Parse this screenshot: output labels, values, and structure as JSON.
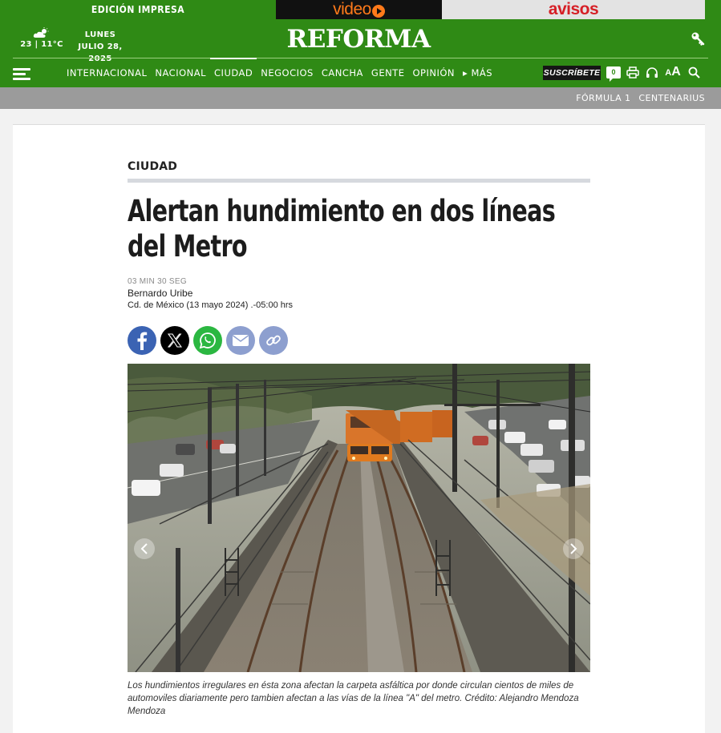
{
  "topbar": {
    "edition_label": "EDICIÓN IMPRESA",
    "video_label": "video",
    "avisos_label": "avisos"
  },
  "header": {
    "weather": "23 | 11°C",
    "weekday": "LUNES",
    "date": "JULIO 28, 2025",
    "logo": "REFORMA"
  },
  "nav": {
    "items": [
      "INTERNACIONAL",
      "NACIONAL",
      "CIUDAD",
      "NEGOCIOS",
      "CANCHA",
      "GENTE",
      "OPINIÓN",
      "▸ MÁS"
    ],
    "active": "CIUDAD",
    "subscribe_label": "SUSCRÍBETE",
    "comment_count": "0",
    "font_size_label": "AA"
  },
  "subnav": {
    "links": [
      "FÓRMULA 1",
      "CENTENARIUS"
    ]
  },
  "article": {
    "section": "CIUDAD",
    "headline": "Alertan hundimiento en dos líneas del Metro",
    "read_time": "03 MIN 30 SEG",
    "author": "Bernardo Uribe",
    "dateline": "Cd. de México (13 mayo 2024) .-05:00 hrs",
    "caption": "Los hundimientos irregulares en ésta zona afectan la carpeta asfáltica por donde circulan cientos de miles de automoviles diariamente pero tambien afectan a las vías de la línea \"A\" del metro. Crédito: Alejandro Mendoza Mendoza"
  },
  "colors": {
    "brand_green": "#2f8a15",
    "video_orange": "#ff7a1a",
    "avisos_red": "#d61f26",
    "train_orange": "#e07a1e"
  }
}
